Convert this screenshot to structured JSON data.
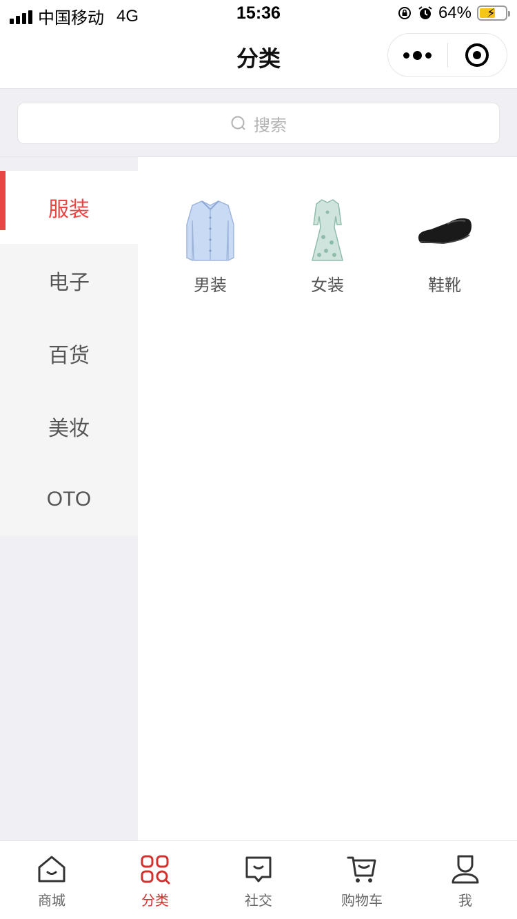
{
  "status_bar": {
    "carrier": "中国移动",
    "network": "4G",
    "time": "15:36",
    "battery": "64%"
  },
  "nav": {
    "title": "分类"
  },
  "search": {
    "placeholder": "搜索"
  },
  "sidebar": {
    "items": [
      {
        "label": "服装"
      },
      {
        "label": "电子"
      },
      {
        "label": "百货"
      },
      {
        "label": "美妆"
      },
      {
        "label": "OTO"
      }
    ]
  },
  "categories": {
    "items": [
      {
        "label": "男装",
        "icon": "shirt-icon"
      },
      {
        "label": "女装",
        "icon": "dress-icon"
      },
      {
        "label": "鞋靴",
        "icon": "shoe-icon"
      }
    ]
  },
  "tab_bar": {
    "items": [
      {
        "label": "商城",
        "icon": "home-icon"
      },
      {
        "label": "分类",
        "icon": "category-icon"
      },
      {
        "label": "社交",
        "icon": "chat-icon"
      },
      {
        "label": "购物车",
        "icon": "cart-icon"
      },
      {
        "label": "我",
        "icon": "user-icon"
      }
    ]
  },
  "colors": {
    "accent": "#e84545",
    "tab_active": "#d2312d",
    "background": "#efeff4"
  }
}
